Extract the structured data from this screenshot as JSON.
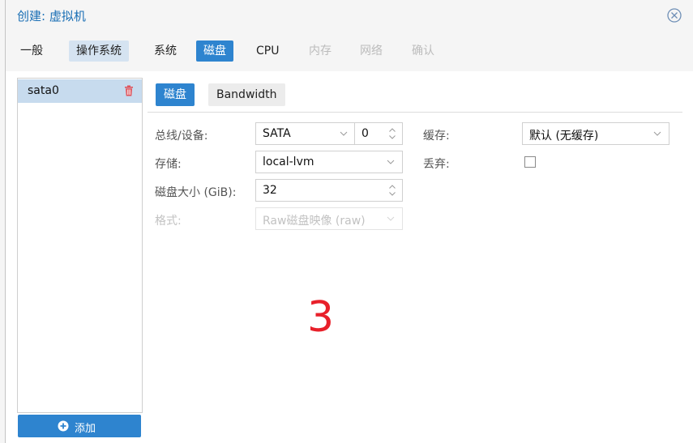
{
  "window": {
    "title": "创建: 虚拟机"
  },
  "tabs": [
    {
      "label": "一般",
      "state": "normal"
    },
    {
      "label": "操作系统",
      "state": "visited"
    },
    {
      "label": "系统",
      "state": "normal"
    },
    {
      "label": "磁盘",
      "state": "active"
    },
    {
      "label": "CPU",
      "state": "normal"
    },
    {
      "label": "内存",
      "state": "disabled"
    },
    {
      "label": "网络",
      "state": "disabled"
    },
    {
      "label": "确认",
      "state": "disabled"
    }
  ],
  "disk_list": {
    "items": [
      {
        "label": "sata0"
      }
    ],
    "add_label": "添加"
  },
  "inner_tabs": {
    "disk": "磁盘",
    "bandwidth": "Bandwidth"
  },
  "form": {
    "bus_label": "总线/设备:",
    "bus_value": "SATA",
    "device_value": "0",
    "storage_label": "存储:",
    "storage_value": "local-lvm",
    "size_label": "磁盘大小 (GiB):",
    "size_value": "32",
    "format_label": "格式:",
    "format_value": "Raw磁盘映像 (raw)",
    "cache_label": "缓存:",
    "cache_value": "默认 (无缓存)",
    "discard_label": "丢弃:",
    "discard_checked": false
  },
  "annotation": {
    "text": "3"
  },
  "colors": {
    "accent": "#2e84cf",
    "visited": "#d5e3f1",
    "title": "#1a6fb5",
    "annotation": "#e8202a",
    "trash": "#e0525a"
  }
}
